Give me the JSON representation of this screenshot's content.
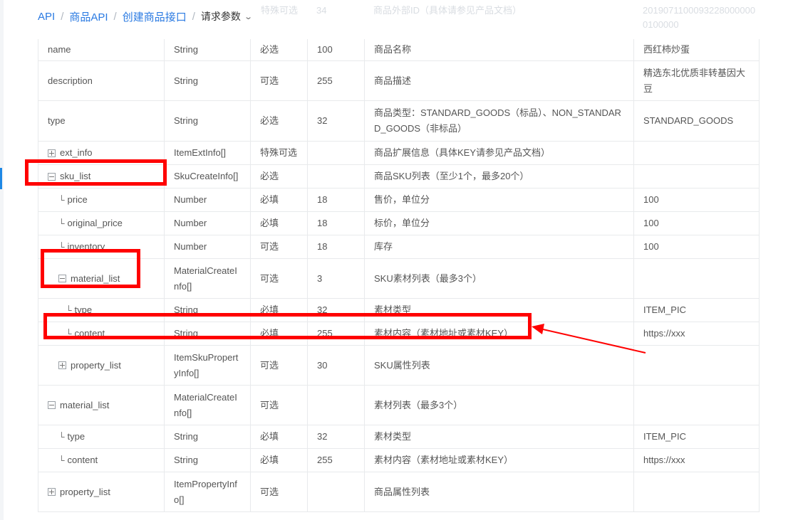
{
  "breadcrumb": {
    "items": [
      "API",
      "商品API",
      "创建商品接口"
    ],
    "current": "请求参数",
    "separator": "/"
  },
  "ghost_row": {
    "required": "特殊可选",
    "length": "34",
    "description": "商品外部ID（具体请参见产品文档）",
    "example_line1": "2019071100093228000000",
    "example_line2": "0100000"
  },
  "table": {
    "rows": [
      {
        "name": "name",
        "type": "String",
        "required": "必选",
        "length": "100",
        "description": "商品名称",
        "example": "西红柿炒蛋"
      },
      {
        "name": "description",
        "type": "String",
        "required": "可选",
        "length": "255",
        "description": "商品描述",
        "example": "精选东北优质非转基因大豆"
      },
      {
        "name": "type",
        "type": "String",
        "required": "必选",
        "length": "32",
        "description": "商品类型：STANDARD_GOODS（标品）、NON_STANDARD_GOODS（非标品）",
        "example": "STANDARD_GOODS"
      },
      {
        "name": "ext_info",
        "type": "ItemExtInfo[]",
        "required": "特殊可选",
        "length": "",
        "description": "商品扩展信息（具体KEY请参见产品文档）",
        "example": ""
      },
      {
        "name": "sku_list",
        "type": "SkuCreateInfo[]",
        "required": "必选",
        "length": "",
        "description": "商品SKU列表（至少1个，最多20个）",
        "example": ""
      },
      {
        "name": "price",
        "type": "Number",
        "required": "必填",
        "length": "18",
        "description": "售价，单位分",
        "example": "100"
      },
      {
        "name": "original_price",
        "type": "Number",
        "required": "必填",
        "length": "18",
        "description": "标价，单位分",
        "example": "100"
      },
      {
        "name": "inventory",
        "type": "Number",
        "required": "可选",
        "length": "18",
        "description": "库存",
        "example": "100"
      },
      {
        "name": "material_list",
        "type": "MaterialCreateInfo[]",
        "required": "可选",
        "length": "3",
        "description": "SKU素材列表（最多3个）",
        "example": ""
      },
      {
        "name": "type",
        "type": "String",
        "required": "必填",
        "length": "32",
        "description": "素材类型",
        "example": "ITEM_PIC"
      },
      {
        "name": "content",
        "type": "String",
        "required": "必填",
        "length": "255",
        "description": "素材内容（素材地址或素材KEY）",
        "example": "https://xxx"
      },
      {
        "name": "property_list",
        "type": "ItemSkuPropertyInfo[]",
        "required": "可选",
        "length": "30",
        "description": "SKU属性列表",
        "example": ""
      },
      {
        "name": "material_list",
        "type": "MaterialCreateInfo[]",
        "required": "可选",
        "length": "",
        "description": "素材列表（最多3个）",
        "example": ""
      },
      {
        "name": "type",
        "type": "String",
        "required": "必填",
        "length": "32",
        "description": "素材类型",
        "example": "ITEM_PIC"
      },
      {
        "name": "content",
        "type": "String",
        "required": "必填",
        "length": "255",
        "description": "素材内容（素材地址或素材KEY）",
        "example": "https://xxx"
      },
      {
        "name": "property_list",
        "type": "ItemPropertyInfo[]",
        "required": "可选",
        "length": "",
        "description": "商品属性列表",
        "example": ""
      }
    ]
  },
  "sub_marker": "└",
  "annotation_color": "#ff0000",
  "accent_color": "#2a7ae2"
}
